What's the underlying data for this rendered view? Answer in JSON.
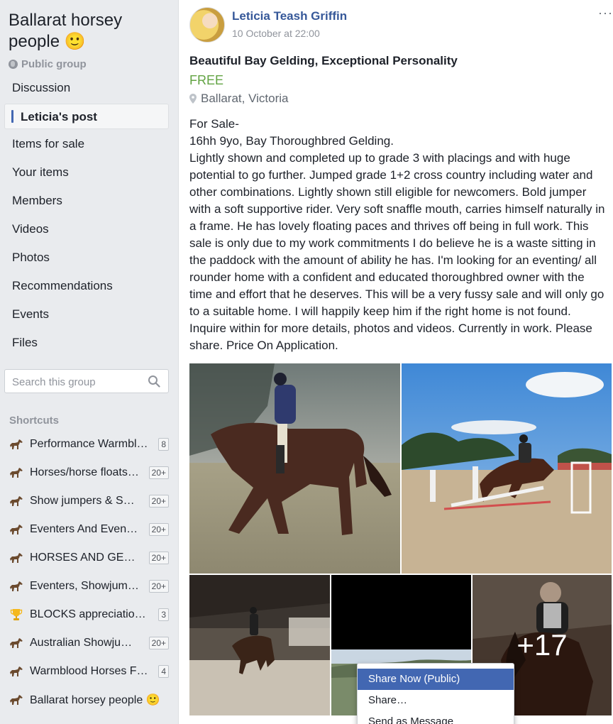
{
  "group": {
    "name": "Ballarat horsey people",
    "name_emoji": "🙂",
    "privacy": "Public group"
  },
  "nav": {
    "items": [
      {
        "label": "Discussion"
      },
      {
        "label": "Leticia's post",
        "active": true
      },
      {
        "label": "Items for sale"
      },
      {
        "label": "Your items"
      },
      {
        "label": "Members"
      },
      {
        "label": "Videos"
      },
      {
        "label": "Photos"
      },
      {
        "label": "Recommendations"
      },
      {
        "label": "Events"
      },
      {
        "label": "Files"
      }
    ]
  },
  "search": {
    "placeholder": "Search this group"
  },
  "shortcuts": {
    "label": "Shortcuts",
    "items": [
      {
        "label": "Performance Warmbl…",
        "badge": "8",
        "icon": "horse-icon"
      },
      {
        "label": "Horses/horse floats…",
        "badge": "20+",
        "icon": "horse-icon"
      },
      {
        "label": "Show jumpers & S…",
        "badge": "20+",
        "icon": "horse-icon"
      },
      {
        "label": "Eventers And Even…",
        "badge": "20+",
        "icon": "horse-icon"
      },
      {
        "label": "HORSES AND GE…",
        "badge": "20+",
        "icon": "horse-icon"
      },
      {
        "label": "Eventers, Showjum…",
        "badge": "20+",
        "icon": "horse-icon"
      },
      {
        "label": "BLOCKS appreciatio…",
        "badge": "3",
        "icon": "trophy-icon"
      },
      {
        "label": "Australian Showju…",
        "badge": "20+",
        "icon": "horse-icon"
      },
      {
        "label": "Warmblood Horses F…",
        "badge": "4",
        "icon": "horse-icon"
      },
      {
        "label": "Ballarat horsey people 🙂",
        "badge": "",
        "icon": "horse-icon"
      }
    ]
  },
  "post": {
    "author": "Leticia Teash Griffin",
    "time": "10 October at 22:00",
    "more": "···",
    "title": "Beautiful Bay Gelding, Exceptional Personality",
    "price": "FREE",
    "location": "Ballarat, Victoria",
    "body": {
      "line1": "For Sale-",
      "line2": "16hh 9yo, Bay Thoroughbred Gelding.",
      "line3": "Lightly shown and completed up to grade 3 with placings and with huge potential to go further. Jumped grade 1+2 cross country including water and other combinations. Lightly shown still eligible for newcomers. Bold jumper with a soft supportive rider. Very soft snaffle mouth, carries himself naturally in a frame. He has lovely floating paces and thrives off being in full work. This sale is only due to my work commitments I do believe he is a waste sitting in the paddock with the amount of ability he has. I'm looking for an eventing/ all rounder home with a confident and educated thoroughbred owner with the time and effort that he deserves. This will be a very fussy sale and will only go to a suitable home. I will happily keep him if the right home is not found. Inquire within for more details, photos and videos. Currently in work. Please share. Price On Application."
    },
    "more_photos": "+17"
  },
  "share_menu": {
    "items": [
      {
        "label": "Share Now (Public)",
        "highlight": true
      },
      {
        "label": "Share…"
      },
      {
        "label": "Send as Message"
      }
    ]
  },
  "colors": {
    "link_blue": "#365899",
    "accent_blue": "#4267b2",
    "price_green": "#62a342",
    "sidebar_bg": "#e9ebee"
  }
}
